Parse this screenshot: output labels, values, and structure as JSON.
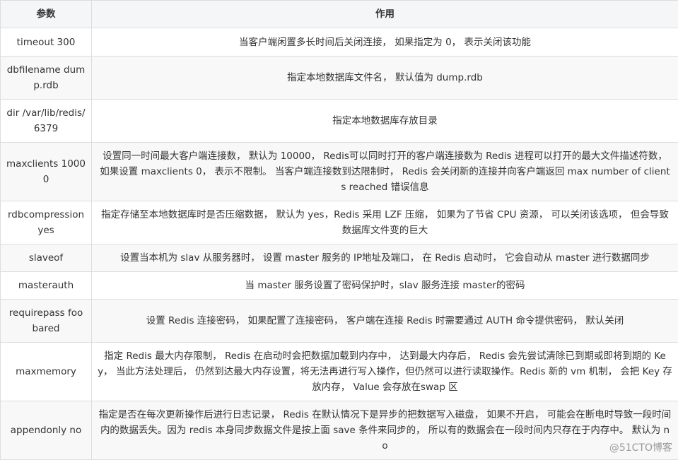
{
  "header": {
    "param": "参数",
    "effect": "作用"
  },
  "rows": [
    {
      "param": "timeout 300",
      "effect": "当客户端闲置多长时间后关闭连接， 如果指定为 0， 表示关闭该功能"
    },
    {
      "param": "dbfilename dump.rdb",
      "effect": "指定本地数据库文件名， 默认值为 dump.rdb"
    },
    {
      "param": "dir /var/lib/redis/6379",
      "effect": "指定本地数据库存放目录"
    },
    {
      "param": "maxclients 10000",
      "effect": "设置同一时间最大客户端连接数， 默认为 10000， Redis可以同时打开的客户端连接数为 Redis 进程可以打开的最大文件描述符数， 如果设置 maxclients 0， 表示不限制。 当客户端连接数到达限制时， Redis 会关闭新的连接并向客户端返回 max number of clients reached 错误信息"
    },
    {
      "param": "rdbcompression yes",
      "effect": "指定存储至本地数据库时是否压缩数据， 默认为 yes，Redis 采用 LZF 压缩， 如果为了节省 CPU 资源， 可以关闭该选项， 但会导致数据库文件变的巨大"
    },
    {
      "param": "slaveof",
      "effect": "设置当本机为 slav 从服务器时， 设置 master 服务的 IP地址及端口， 在 Redis 启动时， 它会自动从 master 进行数据同步"
    },
    {
      "param": "masterauth",
      "effect": "当 master 服务设置了密码保护时，slav 服务连接 master的密码"
    },
    {
      "param": "requirepass foobared",
      "effect": "设置 Redis 连接密码， 如果配置了连接密码， 客户端在连接 Redis 时需要通过 AUTH 命令提供密码， 默认关闭"
    },
    {
      "param": "maxmemory",
      "effect": "指定 Redis 最大内存限制， Redis 在启动时会把数据加载到内存中， 达到最大内存后， Redis 会先尝试清除已到期或即将到期的 Key， 当此方法处理后， 仍然到达最大内存设置，将无法再进行写入操作，但仍然可以进行读取操作。Redis 新的 vm 机制， 会把 Key 存放内存， Value 会存放在swap 区"
    },
    {
      "param": "appendonly no",
      "effect": "指定是否在每次更新操作后进行日志记录， Redis 在默认情况下是异步的把数据写入磁盘， 如果不开启， 可能会在断电时导致一段时间内的数据丢失。因为 redis 本身同步数据文件是按上面 save 条件来同步的， 所以有的数据会在一段时间内只存在于内存中。 默认为 no"
    }
  ],
  "watermark": "@51CTO博客"
}
